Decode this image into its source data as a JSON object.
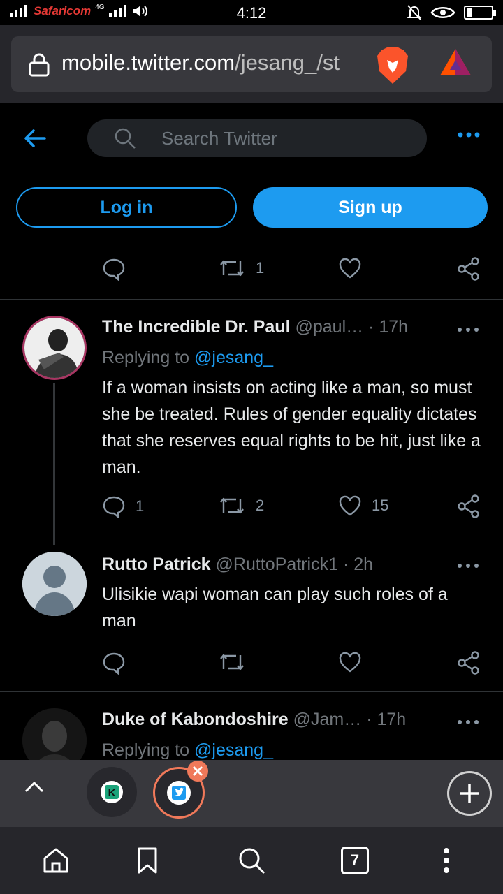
{
  "status_bar": {
    "carrier": "Safaricom",
    "network": "4G",
    "time": "4:12"
  },
  "browser": {
    "url_host": "mobile.twitter.com",
    "url_path": "/jesang_/st",
    "open_tab_count": "7",
    "tabs": [
      {
        "label": "K",
        "icon": "kuda-k-icon"
      },
      {
        "label": "",
        "icon": "twitter-bird-icon"
      }
    ]
  },
  "header": {
    "search_placeholder": "Search Twitter",
    "login_label": "Log in",
    "signup_label": "Sign up"
  },
  "feed": {
    "top_actions": {
      "reply_count": "",
      "retweet_count": "1",
      "like_count": ""
    },
    "tweets": [
      {
        "name": "The Incredible Dr. Paul",
        "handle": "@paul…",
        "time": "· 17h",
        "replying_prefix": "Replying to",
        "replying_to": "@jesang_",
        "text": "If a woman insists on acting like a man, so must she be treated. Rules of gender equality dictates that she reserves equal rights to be hit, just like a man.",
        "reply_count": "1",
        "retweet_count": "2",
        "like_count": "15"
      },
      {
        "name": "Rutto Patrick",
        "handle": "@RuttoPatrick1",
        "time": "· 2h",
        "text": "Ulisikie wapi woman can play such roles of a man",
        "reply_count": "",
        "retweet_count": "",
        "like_count": ""
      },
      {
        "name": "Duke of Kabondoshire",
        "handle": "@Jam…",
        "time": "· 17h",
        "replying_prefix": "Replying to",
        "replying_to": "@jesang_"
      }
    ]
  },
  "colors": {
    "accent": "#1d9bf0",
    "brave_orange": "#fb542b",
    "active_tab_ring": "#f0795a"
  }
}
